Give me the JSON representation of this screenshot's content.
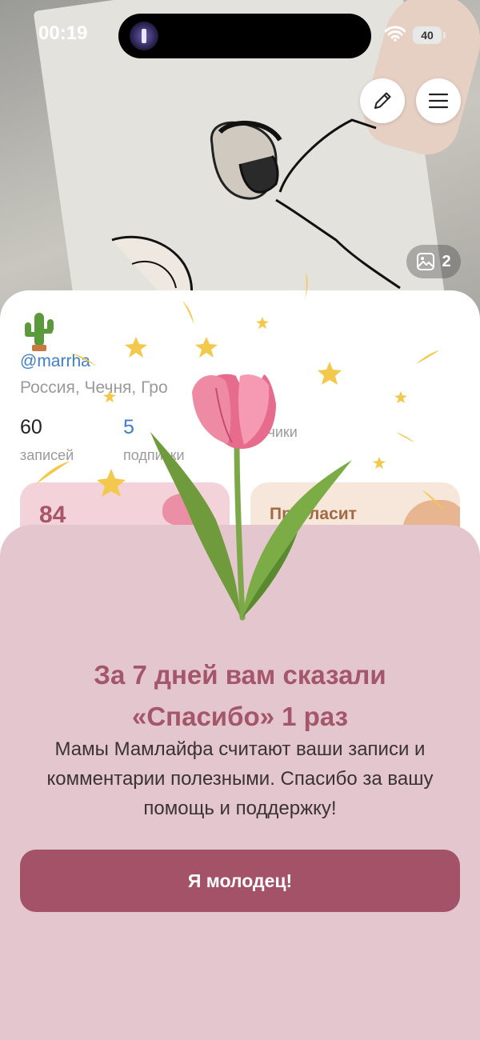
{
  "status_bar": {
    "time": "00:19",
    "battery": "40"
  },
  "header": {
    "edit_icon": "pencil-icon",
    "menu_icon": "hamburger-icon"
  },
  "cover": {
    "photo_icon": "image-icon",
    "photo_count": "2"
  },
  "profile": {
    "avatar_icon": "cactus-icon",
    "username": "@marrha",
    "location": "Россия, Чечня, Гро",
    "stats": [
      {
        "value": "60",
        "label": "записей"
      },
      {
        "value": "5",
        "label": "подписки"
      },
      {
        "value": "",
        "label": "подписчики"
      }
    ],
    "tiles": {
      "left_value": "84",
      "right_text": "Пригласит"
    }
  },
  "sheet": {
    "title_line1": "За 7 дней вам сказали",
    "title_line2": "«Спасибо» 1 раз",
    "text": "Мамы Мамлайфа считают ваши записи и комментарии полезными. Спасибо за вашу помощь и поддержку!",
    "button_label": "Я молодец!"
  },
  "colors": {
    "sheet_bg": "#e3c6ce",
    "accent_title": "#a4566a",
    "button_bg": "#a35267",
    "link_blue": "#3f7ec8",
    "star_yellow": "#f2c94c"
  }
}
